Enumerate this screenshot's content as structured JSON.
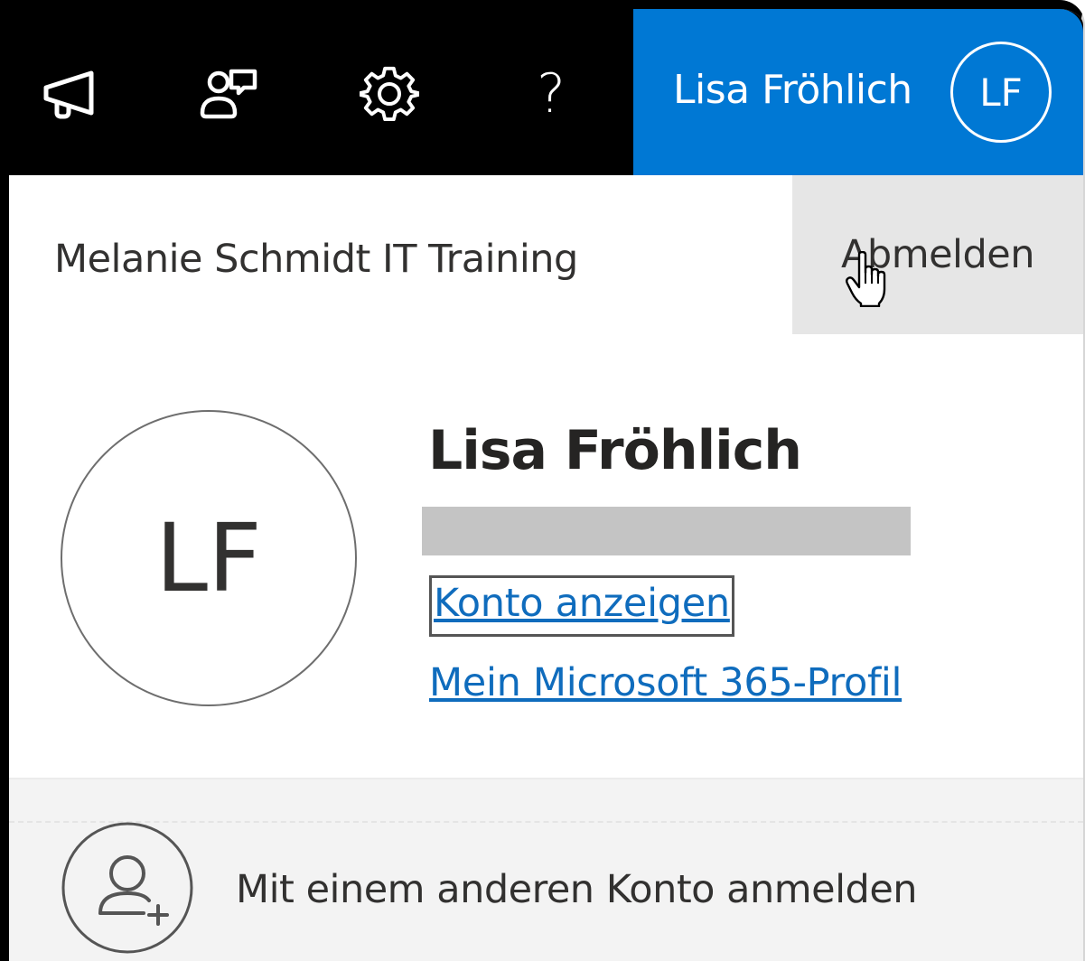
{
  "topbar": {
    "icons": [
      "megaphone-icon",
      "feedback-icon",
      "gear-icon",
      "help-icon"
    ],
    "help_glyph": "?",
    "user_name": "Lisa Fröhlich",
    "user_initials": "LF",
    "background": "#000000",
    "accent": "#0078d4"
  },
  "header": {
    "org_name": "Melanie Schmidt IT Training",
    "signout_label": "Abmelden"
  },
  "profile": {
    "initials": "LF",
    "name": "Lisa Fröhlich",
    "view_account_link": "Konto anzeigen",
    "m365_profile_link": "Mein Microsoft 365-Profil"
  },
  "footer": {
    "add_account_label": "Mit einem anderen Konto anmelden",
    "add_account_icon": "add-person-icon"
  },
  "colors": {
    "link": "#0f6cbd",
    "redaction": "#c4c4c4",
    "signout_hover": "#e6e6e6"
  }
}
